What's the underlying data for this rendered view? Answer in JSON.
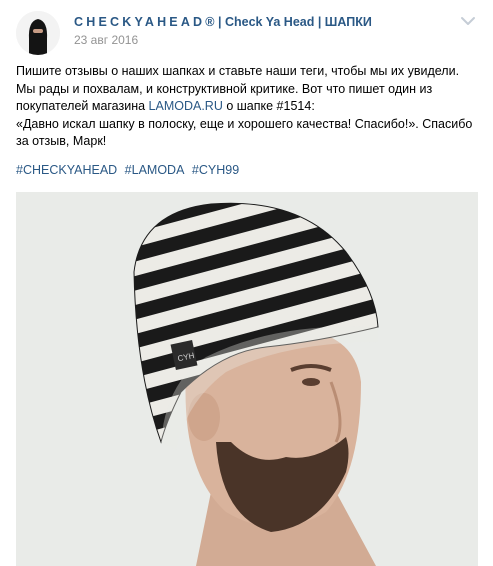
{
  "post": {
    "author": {
      "brand": "CHECKYAHEAD",
      "rest": "® | Check Ya Head | ШАПКИ"
    },
    "date": "23 авг 2016",
    "text": {
      "line_a": "Пишите отзывы о наших шапках и ставьте наши теги, чтобы мы их увидели. Мы рады и похвалам, и конструктивной критике. Вот что пишет один из покупателей магазина ",
      "link": "LAMODA.RU",
      "line_b": " о шапке #1514:",
      "quote": "«Давно искал шапку в полоску, еще и хорошего качества! Спасибо!». Спасибо за отзыв, Марк!"
    },
    "hashtags": [
      "#CHECKYAHEAD",
      "#LAMODA",
      "#CYH99"
    ],
    "photo": {
      "label_text": "CYH",
      "colors": {
        "background": "#e9ebe8",
        "stripe_dark": "#1a1a1a",
        "stripe_light": "#ecebe6",
        "skin": "#d9b39c",
        "beard": "#4a3428"
      }
    }
  },
  "icons": {
    "more": "chevron-down-icon"
  }
}
